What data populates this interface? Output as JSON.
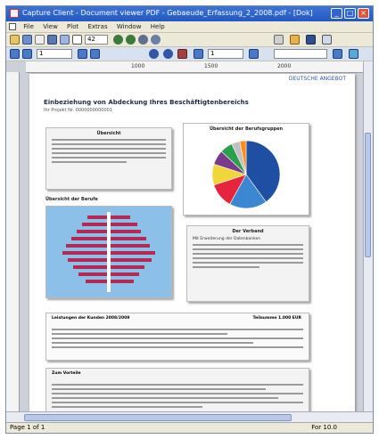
{
  "window": {
    "title": "Capture Client - Document viewer PDF - Gebaeude_Erfassung_2_2008.pdf - [Dok]"
  },
  "menu": [
    "File",
    "View",
    "Plot",
    "Extras",
    "Window",
    "Help"
  ],
  "toolbar": {
    "zoom": "42",
    "page_current": "1",
    "page_total": "1"
  },
  "document": {
    "header_tag": "DEUTSCHE ANGEBOT",
    "title": "Einbeziehung von Abdeckung Ihres Beschäftigtenbereichs",
    "subtitle": "Ihr Projekt Nr. 0000000000001",
    "box1_title": "Übersicht",
    "pie_title": "Übersicht der Berufsgruppen",
    "pyramid_title": "Übersicht der Berufe",
    "box3_title": "Der Verband",
    "box3_subtitle": "Mit Erweiterung der Datenbanken",
    "table_title": "Leistungen der Kunden 2008/2009",
    "table_right_title": "Teilsumme 1.000 EUR",
    "notes_title": "Zum Vorteile"
  },
  "ruler": {
    "t1": "1000",
    "t2": "1500",
    "t3": "2000"
  },
  "statusbar": {
    "left": "Page 1 of 1",
    "right": "For 10.0"
  },
  "chart_data": {
    "type": "pie",
    "title": "Übersicht der Berufsgruppen",
    "values": [
      40,
      18,
      12,
      10,
      7,
      6,
      4,
      3
    ],
    "colors": [
      "#1f4fa3",
      "#3b87d2",
      "#e6243d",
      "#f1d63b",
      "#7a3a8c",
      "#2aa04a",
      "#c0c0c0",
      "#ff8c1a"
    ]
  },
  "colors": {
    "accent": "#2357c2",
    "page_bg": "#ffffff"
  }
}
